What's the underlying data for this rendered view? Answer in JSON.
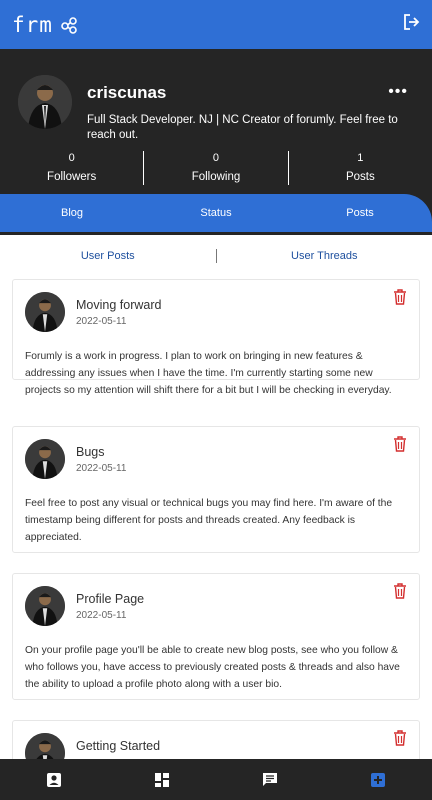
{
  "app": {
    "logo_text": "frm"
  },
  "profile": {
    "username": "criscunas",
    "bio": "Full Stack Developer. NJ | NC Creator of forumly. Feel free to reach out.",
    "more_label": "•••"
  },
  "stats": [
    {
      "count": "0",
      "label": "Followers"
    },
    {
      "count": "0",
      "label": "Following"
    },
    {
      "count": "1",
      "label": "Posts"
    }
  ],
  "tabs": [
    "Blog",
    "Status",
    "Posts"
  ],
  "subtabs": [
    "User Posts",
    "User Threads"
  ],
  "posts": [
    {
      "title": "Moving forward",
      "date": "2022-05-11",
      "body": "Forumly is a work in progress. I plan to work on bringing in new features & addressing any issues when I have the time. I'm currently starting some new projects so my attention will shift there for a bit but I will be checking in everyday."
    },
    {
      "title": "Bugs",
      "date": "2022-05-11",
      "body": "Feel free to post any visual or technical bugs you may find here. I'm aware of the timestamp being different for posts and threads created. Any feedback is appreciated."
    },
    {
      "title": "Profile Page",
      "date": "2022-05-11",
      "body": "On your profile page you'll be able to create new blog posts, see who you follow & who follows you, have access to previously created posts & threads and also have the ability to upload a profile photo along with a user bio."
    },
    {
      "title": "Getting Started",
      "date": "",
      "body": ""
    }
  ],
  "colors": {
    "primary": "#2f6fd5",
    "dark": "#252525",
    "delete": "#d32f2f",
    "link": "#1d4f9e"
  },
  "icons": {
    "logo_mark": "molecule-icon",
    "logout": "logout-icon",
    "delete": "trash-icon",
    "nav": [
      "profile-icon",
      "dashboard-icon",
      "chat-icon",
      "add-box-icon"
    ]
  }
}
